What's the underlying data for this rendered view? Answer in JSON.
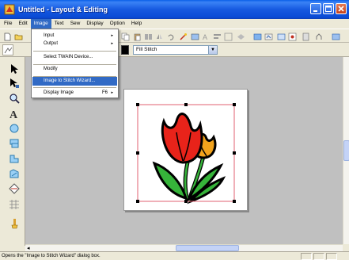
{
  "window": {
    "title": "Untitled - Layout & Editing",
    "buttons": [
      "minimize",
      "maximize",
      "close"
    ]
  },
  "menubar": {
    "items": [
      "File",
      "Edit",
      "Image",
      "Text",
      "Sew",
      "Display",
      "Option",
      "Help"
    ],
    "active": "Image"
  },
  "image_menu": {
    "items": [
      {
        "label": "Input",
        "submenu": "▸"
      },
      {
        "label": "Output",
        "submenu": "▸"
      },
      {
        "label": "Select TWAIN Device..."
      },
      {
        "label": "Modify"
      },
      {
        "label": "Image to Stitch Wizard...",
        "highlighted": true
      },
      {
        "label": "Display Image",
        "shortcut": "F6",
        "submenu": "▸"
      }
    ]
  },
  "toolbar": {
    "stitch_type": "Fill Stitch",
    "dropdown_arrow": "▼"
  },
  "scroll": {
    "left_arrow": "◂"
  },
  "statusbar": {
    "text": "Opens the \"Image to Stitch Wizard\" dialog box."
  },
  "colors": {
    "title_bar": "#0a4bd6",
    "menu_highlight": "#316ac5",
    "workspace": "#c0c0c0",
    "selection": "#e06070",
    "tulip_red": "#e8231a",
    "tulip_orange": "#f2a31c",
    "leaf_green": "#36b43a"
  }
}
